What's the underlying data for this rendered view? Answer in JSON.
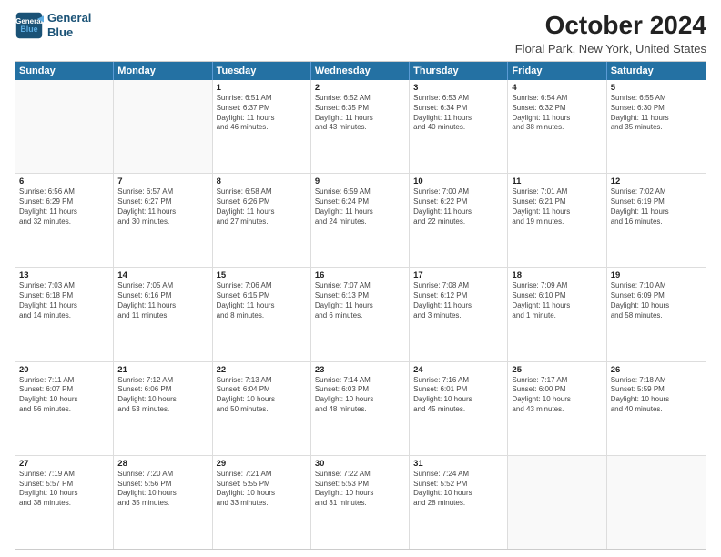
{
  "header": {
    "logo_line1": "General",
    "logo_line2": "Blue",
    "title": "October 2024",
    "subtitle": "Floral Park, New York, United States"
  },
  "calendar": {
    "days_of_week": [
      "Sunday",
      "Monday",
      "Tuesday",
      "Wednesday",
      "Thursday",
      "Friday",
      "Saturday"
    ],
    "rows": [
      [
        {
          "day": "",
          "lines": [],
          "empty": true
        },
        {
          "day": "",
          "lines": [],
          "empty": true
        },
        {
          "day": "1",
          "lines": [
            "Sunrise: 6:51 AM",
            "Sunset: 6:37 PM",
            "Daylight: 11 hours",
            "and 46 minutes."
          ]
        },
        {
          "day": "2",
          "lines": [
            "Sunrise: 6:52 AM",
            "Sunset: 6:35 PM",
            "Daylight: 11 hours",
            "and 43 minutes."
          ]
        },
        {
          "day": "3",
          "lines": [
            "Sunrise: 6:53 AM",
            "Sunset: 6:34 PM",
            "Daylight: 11 hours",
            "and 40 minutes."
          ]
        },
        {
          "day": "4",
          "lines": [
            "Sunrise: 6:54 AM",
            "Sunset: 6:32 PM",
            "Daylight: 11 hours",
            "and 38 minutes."
          ]
        },
        {
          "day": "5",
          "lines": [
            "Sunrise: 6:55 AM",
            "Sunset: 6:30 PM",
            "Daylight: 11 hours",
            "and 35 minutes."
          ]
        }
      ],
      [
        {
          "day": "6",
          "lines": [
            "Sunrise: 6:56 AM",
            "Sunset: 6:29 PM",
            "Daylight: 11 hours",
            "and 32 minutes."
          ]
        },
        {
          "day": "7",
          "lines": [
            "Sunrise: 6:57 AM",
            "Sunset: 6:27 PM",
            "Daylight: 11 hours",
            "and 30 minutes."
          ]
        },
        {
          "day": "8",
          "lines": [
            "Sunrise: 6:58 AM",
            "Sunset: 6:26 PM",
            "Daylight: 11 hours",
            "and 27 minutes."
          ]
        },
        {
          "day": "9",
          "lines": [
            "Sunrise: 6:59 AM",
            "Sunset: 6:24 PM",
            "Daylight: 11 hours",
            "and 24 minutes."
          ]
        },
        {
          "day": "10",
          "lines": [
            "Sunrise: 7:00 AM",
            "Sunset: 6:22 PM",
            "Daylight: 11 hours",
            "and 22 minutes."
          ]
        },
        {
          "day": "11",
          "lines": [
            "Sunrise: 7:01 AM",
            "Sunset: 6:21 PM",
            "Daylight: 11 hours",
            "and 19 minutes."
          ]
        },
        {
          "day": "12",
          "lines": [
            "Sunrise: 7:02 AM",
            "Sunset: 6:19 PM",
            "Daylight: 11 hours",
            "and 16 minutes."
          ]
        }
      ],
      [
        {
          "day": "13",
          "lines": [
            "Sunrise: 7:03 AM",
            "Sunset: 6:18 PM",
            "Daylight: 11 hours",
            "and 14 minutes."
          ]
        },
        {
          "day": "14",
          "lines": [
            "Sunrise: 7:05 AM",
            "Sunset: 6:16 PM",
            "Daylight: 11 hours",
            "and 11 minutes."
          ]
        },
        {
          "day": "15",
          "lines": [
            "Sunrise: 7:06 AM",
            "Sunset: 6:15 PM",
            "Daylight: 11 hours",
            "and 8 minutes."
          ]
        },
        {
          "day": "16",
          "lines": [
            "Sunrise: 7:07 AM",
            "Sunset: 6:13 PM",
            "Daylight: 11 hours",
            "and 6 minutes."
          ]
        },
        {
          "day": "17",
          "lines": [
            "Sunrise: 7:08 AM",
            "Sunset: 6:12 PM",
            "Daylight: 11 hours",
            "and 3 minutes."
          ]
        },
        {
          "day": "18",
          "lines": [
            "Sunrise: 7:09 AM",
            "Sunset: 6:10 PM",
            "Daylight: 11 hours",
            "and 1 minute."
          ]
        },
        {
          "day": "19",
          "lines": [
            "Sunrise: 7:10 AM",
            "Sunset: 6:09 PM",
            "Daylight: 10 hours",
            "and 58 minutes."
          ]
        }
      ],
      [
        {
          "day": "20",
          "lines": [
            "Sunrise: 7:11 AM",
            "Sunset: 6:07 PM",
            "Daylight: 10 hours",
            "and 56 minutes."
          ]
        },
        {
          "day": "21",
          "lines": [
            "Sunrise: 7:12 AM",
            "Sunset: 6:06 PM",
            "Daylight: 10 hours",
            "and 53 minutes."
          ]
        },
        {
          "day": "22",
          "lines": [
            "Sunrise: 7:13 AM",
            "Sunset: 6:04 PM",
            "Daylight: 10 hours",
            "and 50 minutes."
          ]
        },
        {
          "day": "23",
          "lines": [
            "Sunrise: 7:14 AM",
            "Sunset: 6:03 PM",
            "Daylight: 10 hours",
            "and 48 minutes."
          ]
        },
        {
          "day": "24",
          "lines": [
            "Sunrise: 7:16 AM",
            "Sunset: 6:01 PM",
            "Daylight: 10 hours",
            "and 45 minutes."
          ]
        },
        {
          "day": "25",
          "lines": [
            "Sunrise: 7:17 AM",
            "Sunset: 6:00 PM",
            "Daylight: 10 hours",
            "and 43 minutes."
          ]
        },
        {
          "day": "26",
          "lines": [
            "Sunrise: 7:18 AM",
            "Sunset: 5:59 PM",
            "Daylight: 10 hours",
            "and 40 minutes."
          ]
        }
      ],
      [
        {
          "day": "27",
          "lines": [
            "Sunrise: 7:19 AM",
            "Sunset: 5:57 PM",
            "Daylight: 10 hours",
            "and 38 minutes."
          ]
        },
        {
          "day": "28",
          "lines": [
            "Sunrise: 7:20 AM",
            "Sunset: 5:56 PM",
            "Daylight: 10 hours",
            "and 35 minutes."
          ]
        },
        {
          "day": "29",
          "lines": [
            "Sunrise: 7:21 AM",
            "Sunset: 5:55 PM",
            "Daylight: 10 hours",
            "and 33 minutes."
          ]
        },
        {
          "day": "30",
          "lines": [
            "Sunrise: 7:22 AM",
            "Sunset: 5:53 PM",
            "Daylight: 10 hours",
            "and 31 minutes."
          ]
        },
        {
          "day": "31",
          "lines": [
            "Sunrise: 7:24 AM",
            "Sunset: 5:52 PM",
            "Daylight: 10 hours",
            "and 28 minutes."
          ]
        },
        {
          "day": "",
          "lines": [],
          "empty": true
        },
        {
          "day": "",
          "lines": [],
          "empty": true
        }
      ]
    ]
  }
}
